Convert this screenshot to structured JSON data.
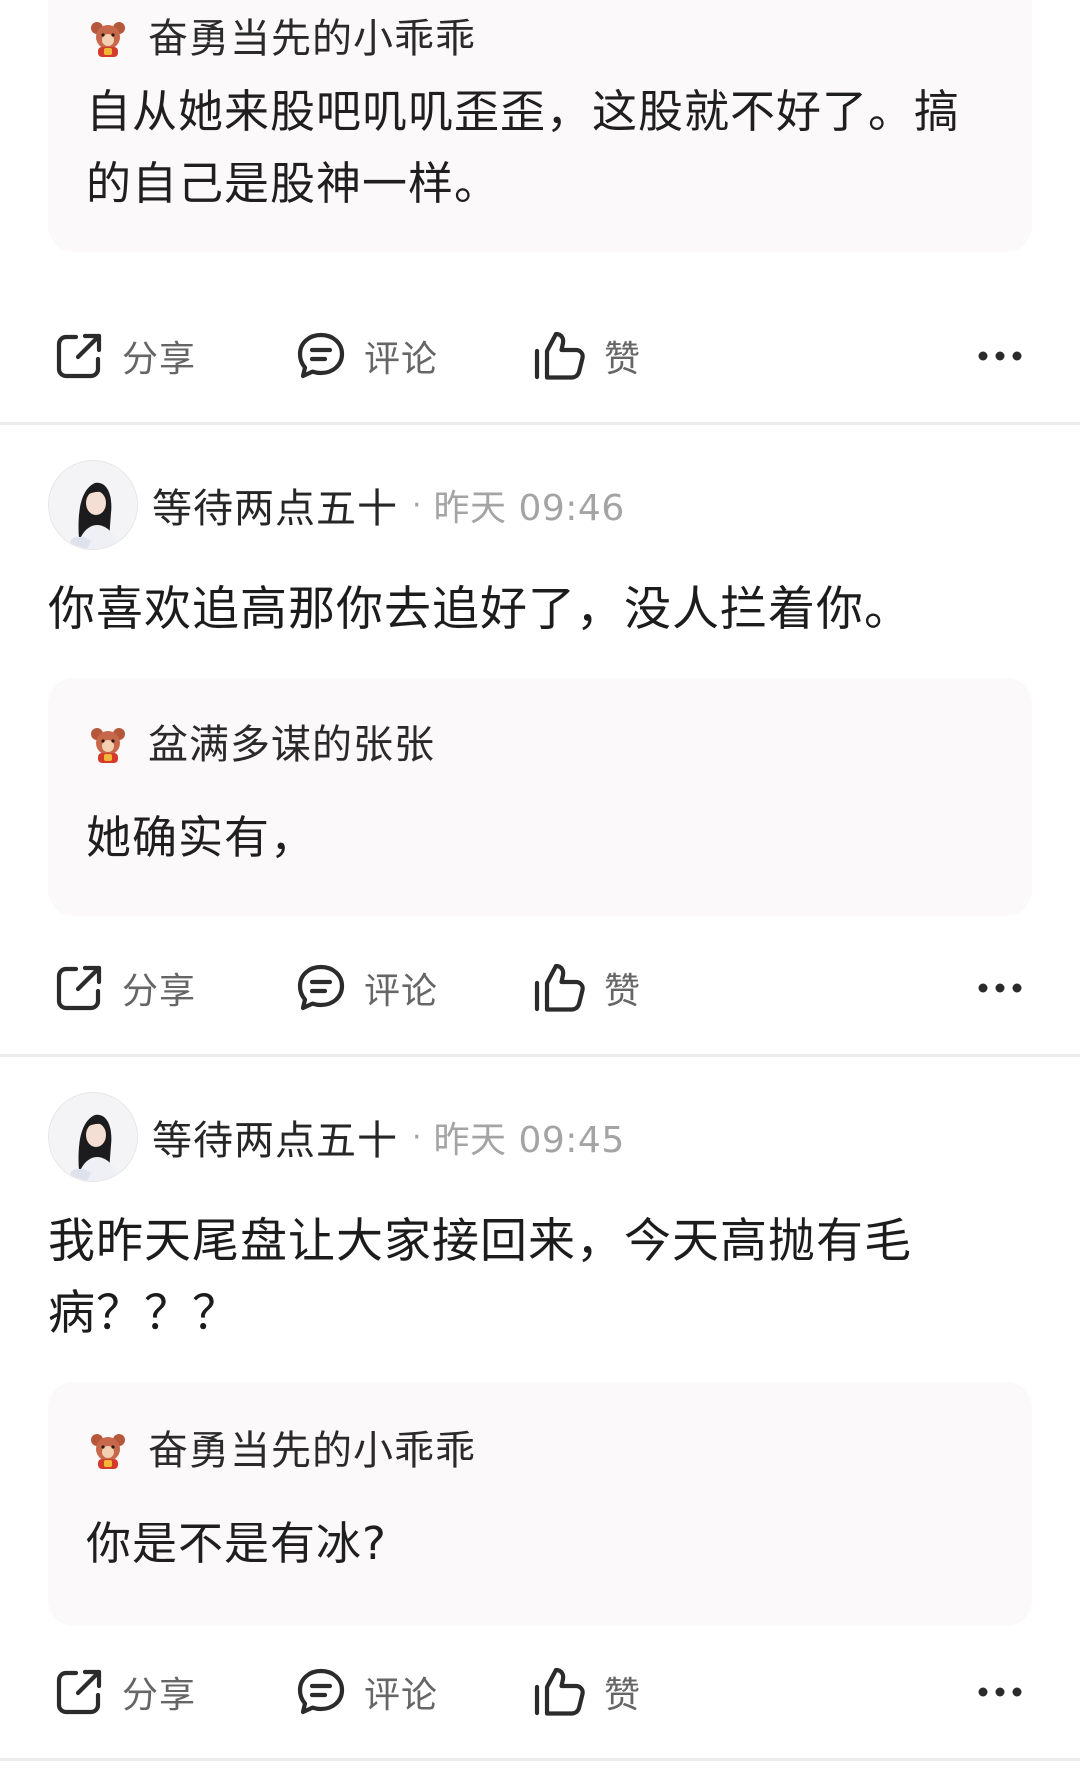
{
  "feed": {
    "top_quote": {
      "user": "奋勇当先的小乖乖",
      "text": "自从她来股吧叽叽歪歪，这股就不好了。搞的自己是股神一样。"
    },
    "posts": [
      {
        "author": "等待两点五十",
        "separator": "·",
        "time": "昨天 09:46",
        "text": "你喜欢追高那你去追好了，没人拦着你。",
        "quote": {
          "user": "盆满多谋的张张",
          "text": "她确实有，"
        }
      },
      {
        "author": "等待两点五十",
        "separator": "·",
        "time": "昨天 09:45",
        "text": "我昨天尾盘让大家接回来，今天高抛有毛病？？？",
        "quote": {
          "user": "奋勇当先的小乖乖",
          "text": "你是不是有冰?"
        }
      }
    ]
  },
  "actions": {
    "share": "分享",
    "comment": "评论",
    "like": "赞"
  },
  "icons": {
    "share": "share-icon",
    "comment": "comment-icon",
    "like": "thumbs-up-icon",
    "more": "more-horizontal-icon",
    "quote_user": "fortune-bear-icon"
  },
  "colors": {
    "quote_background": "#fcf9fb",
    "meta_text": "#a4a4a4",
    "action_text": "#666666",
    "divider": "#ececec"
  }
}
